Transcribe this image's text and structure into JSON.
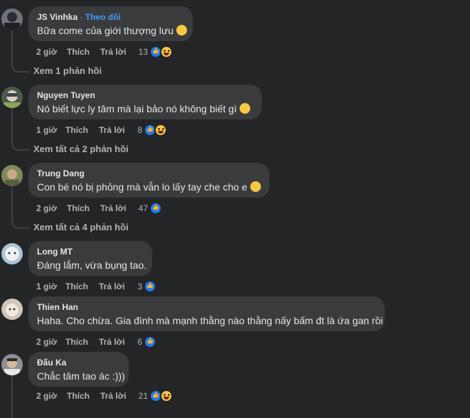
{
  "actions": {
    "like": "Thích",
    "reply": "Trả lời"
  },
  "comments": [
    {
      "author": "JS Vinhka",
      "follow": "Theo dõi",
      "text": "Bữa come của giới thượng lưu",
      "emoji": "rolling-laughing-emoji",
      "time": "2 giờ",
      "count": "13",
      "reactions": [
        "like",
        "haha"
      ],
      "replies": "Xem 1 phản hồi"
    },
    {
      "author": "Nguyen Tuyen",
      "text": "Nó biết lực ly tâm mà lại bảo nó không biết gì",
      "emoji": "pacman-emoji",
      "time": "1 giờ",
      "count": "8",
      "reactions": [
        "like",
        "haha"
      ],
      "replies": "Xem tất cả 2 phản hồi"
    },
    {
      "author": "Trung Dang",
      "text": "Con bé nó bị phỏng mà vẫn lo lấy tay che cho e",
      "emoji": "pleading-face-emoji",
      "time": "2 giờ",
      "count": "47",
      "reactions": [
        "like"
      ],
      "replies": "Xem tất cả 4 phản hồi"
    },
    {
      "author": "Long MT",
      "text": "Đáng lắm, vừa bụng tao.",
      "time": "1 giờ",
      "count": "3",
      "reactions": [
        "like"
      ]
    },
    {
      "author": "Thien Han",
      "text": "Haha. Cho chừa. Gia đình mà mạnh thằng nào thằng nấy bấm đt là ứa gan rồi",
      "time": "2 giờ",
      "count": "6",
      "reactions": [
        "like"
      ]
    },
    {
      "author": "Đấu Ka",
      "text": "Chắc tâm tao ác :)))",
      "time": "2 giờ",
      "count": "21",
      "reactions": [
        "like",
        "haha"
      ]
    }
  ],
  "colors": {
    "background": "#242526",
    "bubble": "#3a3b3c",
    "accent": "#4599ff",
    "like": "#2078f4"
  }
}
